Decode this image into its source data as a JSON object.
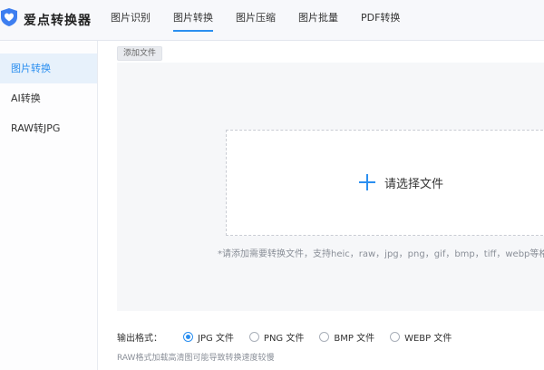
{
  "app": {
    "title": "爱点转换器",
    "logo_icon": "heart-shield-logo"
  },
  "nav": {
    "tabs": [
      {
        "label": "图片识别",
        "active": false
      },
      {
        "label": "图片转换",
        "active": true
      },
      {
        "label": "图片压缩",
        "active": false
      },
      {
        "label": "图片批量",
        "active": false
      },
      {
        "label": "PDF转换",
        "active": false
      }
    ]
  },
  "sidebar": {
    "items": [
      {
        "label": "图片转换",
        "active": true
      },
      {
        "label": "AI转换",
        "active": false
      },
      {
        "label": "RAW转JPG",
        "active": false
      }
    ]
  },
  "main": {
    "add_file_label": "添加文件",
    "dropzone": {
      "choose_label": "请选择文件",
      "hint": "*请添加需要转换文件，支持heic，raw，jpg，png，gif，bmp，tiff，webp等格式"
    },
    "output": {
      "label": "输出格式：",
      "options": [
        {
          "label": "JPG 文件",
          "selected": true
        },
        {
          "label": "PNG 文件",
          "selected": false
        },
        {
          "label": "BMP 文件",
          "selected": false
        },
        {
          "label": "WEBP 文件",
          "selected": false
        }
      ]
    },
    "note": "RAW格式加载高清图可能导致转换速度较慢"
  },
  "colors": {
    "accent": "#2b8ff0",
    "sidebar_active_bg": "#e7f1fb"
  }
}
